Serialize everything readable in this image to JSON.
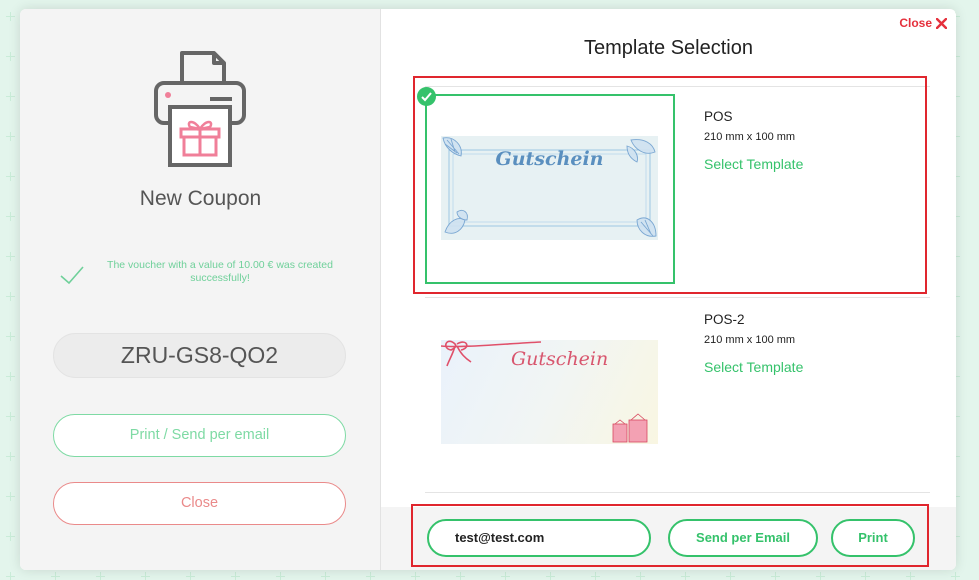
{
  "left_panel": {
    "title": "New Coupon",
    "success_message": "The voucher with a value of 10.00 € was created successfully!",
    "coupon_code": "ZRU-GS8-QO2",
    "print_send_label": "Print / Send per email",
    "close_label": "Close"
  },
  "right_panel": {
    "close_label": "Close",
    "title": "Template Selection",
    "templates": [
      {
        "name": "POS",
        "size": "210 mm x 100 mm",
        "select_label": "Select Template",
        "image_text": "Gutschein",
        "selected": true
      },
      {
        "name": "POS-2",
        "size": "210 mm x 100 mm",
        "select_label": "Select Template",
        "image_text": "Gutschein",
        "selected": false
      }
    ],
    "footer": {
      "email_value": "test@test.com",
      "send_label": "Send per Email",
      "print_label": "Print"
    }
  },
  "colors": {
    "accent_green": "#35c26b",
    "close_red": "#e5303c",
    "highlight_red": "#e0262e",
    "left_close_red": "#ea8a8a",
    "pink_icon": "#f07f99"
  },
  "icons": [
    "printer-gift-icon",
    "checkmark-icon",
    "close-x-icon",
    "selected-check-icon"
  ]
}
